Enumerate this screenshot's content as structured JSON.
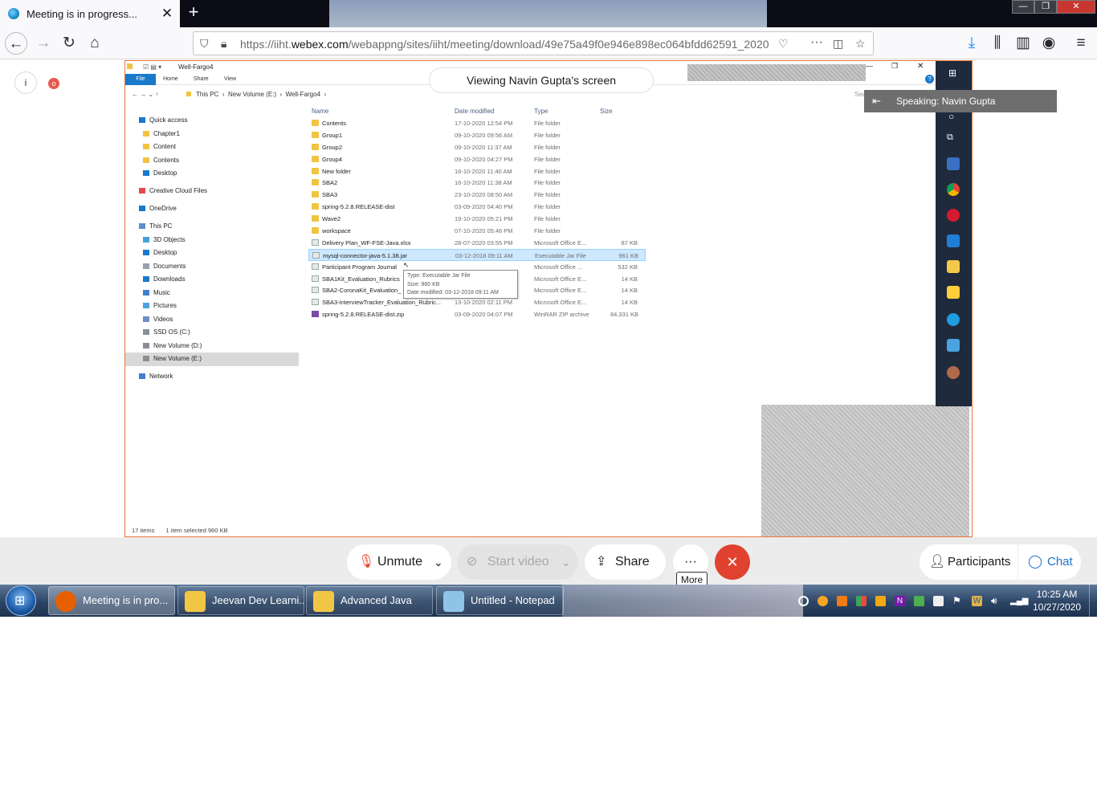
{
  "browser": {
    "tab_title": "Meeting is in progress...",
    "tab_close": "✕",
    "new_tab": "+",
    "url_prefix": "https://iiht.",
    "url_domain": "webex.com",
    "url_path": "/webappng/sites/iiht/meeting/download/49e75a49f0e946e898ec064bfdd62591_2020",
    "window_controls": [
      "—",
      "❐",
      "✕"
    ]
  },
  "meeting": {
    "viewing_label": "Viewing Navin Gupta's screen",
    "speaking_label": "Speaking: Navin Gupta",
    "info_badge": "i",
    "record_badge": "o",
    "controls": {
      "unmute": "Unmute",
      "start_video": "Start video",
      "share": "Share",
      "more": "···",
      "more_tooltip": "More",
      "participants": "Participants",
      "chat": "Chat"
    }
  },
  "explorer": {
    "window_title": "Well-Fargo4",
    "ribbon": [
      "File",
      "Home",
      "Share",
      "View"
    ],
    "breadcrumb": [
      "This PC",
      "New Volume (E:)",
      "Well-Fargo4"
    ],
    "search_placeholder": "Search We...",
    "nav": [
      {
        "label": "Quick access",
        "indent": 0,
        "icon": "star"
      },
      {
        "label": "Chapter1",
        "indent": 1,
        "icon": "folder"
      },
      {
        "label": "Content",
        "indent": 1,
        "icon": "folder"
      },
      {
        "label": "Contents",
        "indent": 1,
        "icon": "folder"
      },
      {
        "label": "Desktop",
        "indent": 1,
        "icon": "desktop"
      },
      {
        "label": "",
        "indent": 0,
        "icon": "spacer"
      },
      {
        "label": "Creative Cloud Files",
        "indent": 0,
        "icon": "cc"
      },
      {
        "label": "",
        "indent": 0,
        "icon": "spacer"
      },
      {
        "label": "OneDrive",
        "indent": 0,
        "icon": "cloud"
      },
      {
        "label": "",
        "indent": 0,
        "icon": "spacer"
      },
      {
        "label": "This PC",
        "indent": 0,
        "icon": "pc"
      },
      {
        "label": "3D Objects",
        "indent": 1,
        "icon": "obj"
      },
      {
        "label": "Desktop",
        "indent": 1,
        "icon": "desktop"
      },
      {
        "label": "Documents",
        "indent": 1,
        "icon": "docs"
      },
      {
        "label": "Downloads",
        "indent": 1,
        "icon": "down"
      },
      {
        "label": "Music",
        "indent": 1,
        "icon": "music"
      },
      {
        "label": "Pictures",
        "indent": 1,
        "icon": "pics"
      },
      {
        "label": "Videos",
        "indent": 1,
        "icon": "video"
      },
      {
        "label": "SSD OS (C:)",
        "indent": 1,
        "icon": "drive"
      },
      {
        "label": "New Volume (D:)",
        "indent": 1,
        "icon": "drive"
      },
      {
        "label": "New Volume (E:)",
        "indent": 1,
        "icon": "drive",
        "selected": true
      },
      {
        "label": "",
        "indent": 0,
        "icon": "spacer"
      },
      {
        "label": "Network",
        "indent": 0,
        "icon": "net"
      }
    ],
    "columns": [
      "Name",
      "Date modified",
      "Type",
      "Size"
    ],
    "files": [
      {
        "name": "Contents",
        "date": "17-10-2020 12:54 PM",
        "type": "File folder",
        "size": "",
        "kind": "folder"
      },
      {
        "name": "Group1",
        "date": "09-10-2020 09:56 AM",
        "type": "File folder",
        "size": "",
        "kind": "folder"
      },
      {
        "name": "Group2",
        "date": "09-10-2020 11:37 AM",
        "type": "File folder",
        "size": "",
        "kind": "folder"
      },
      {
        "name": "Group4",
        "date": "09-10-2020 04:27 PM",
        "type": "File folder",
        "size": "",
        "kind": "folder"
      },
      {
        "name": "New folder",
        "date": "16-10-2020 11:40 AM",
        "type": "File folder",
        "size": "",
        "kind": "folder"
      },
      {
        "name": "SBA2",
        "date": "16-10-2020 11:38 AM",
        "type": "File folder",
        "size": "",
        "kind": "folder"
      },
      {
        "name": "SBA3",
        "date": "23-10-2020 08:50 AM",
        "type": "File folder",
        "size": "",
        "kind": "folder"
      },
      {
        "name": "spring-5.2.8.RELEASE-dist",
        "date": "03-09-2020 04:40 PM",
        "type": "File folder",
        "size": "",
        "kind": "folder"
      },
      {
        "name": "Wave2",
        "date": "19-10-2020 05:21 PM",
        "type": "File folder",
        "size": "",
        "kind": "folder"
      },
      {
        "name": "workspace",
        "date": "07-10-2020 05:46 PM",
        "type": "File folder",
        "size": "",
        "kind": "folder"
      },
      {
        "name": "Delivery Plan_WF-FSE-Java.xlsx",
        "date": "28-07-2020 03:55 PM",
        "type": "Microsoft Office E...",
        "size": "87 KB",
        "kind": "doc"
      },
      {
        "name": "mysql-connector-java-5.1.38.jar",
        "date": "03-12-2018 09:11 AM",
        "type": "Executable Jar File",
        "size": "961 KB",
        "kind": "doc",
        "selected": true
      },
      {
        "name": "Participant Program Journal",
        "date": "",
        "type": "Microsoft Office ...",
        "size": "532 KB",
        "kind": "doc"
      },
      {
        "name": "SBA1Kit_Evaluation_Rubrics",
        "date": "",
        "type": "Microsoft Office E...",
        "size": "14 KB",
        "kind": "doc"
      },
      {
        "name": "SBA2-CoronaKit_Evaluation_",
        "date": "",
        "type": "Microsoft Office E...",
        "size": "14 KB",
        "kind": "doc"
      },
      {
        "name": "SBA3-InterviewTracker_Evaluation_Rubric...",
        "date": "13-10-2020 02:11 PM",
        "type": "Microsoft Office E...",
        "size": "14 KB",
        "kind": "doc"
      },
      {
        "name": "spring-5.2.8.RELEASE-dist.zip",
        "date": "03-09-2020 04:07 PM",
        "type": "WinRAR ZIP archive",
        "size": "84,331 KB",
        "kind": "zip"
      }
    ],
    "tooltip": {
      "type": "Type: Executable Jar File",
      "size": "Size: 960 KB",
      "date": "Date modified: 03-12-2018 09:11 AM"
    },
    "status_count": "17 items",
    "status_selected": "1 item selected  960 KB"
  },
  "taskbar": {
    "buttons": [
      {
        "label": "Meeting is in pro...",
        "icon_color": "#e66000",
        "active": true
      },
      {
        "label": "Jeevan Dev Learni...",
        "icon_color": "#f1c644",
        "active": false
      },
      {
        "label": "Advanced Java",
        "icon_color": "#f1c644",
        "active": false
      },
      {
        "label": "Untitled - Notepad",
        "icon_color": "#8fc3e8",
        "active": false
      }
    ],
    "time": "10:25 AM",
    "date": "10/27/2020"
  }
}
